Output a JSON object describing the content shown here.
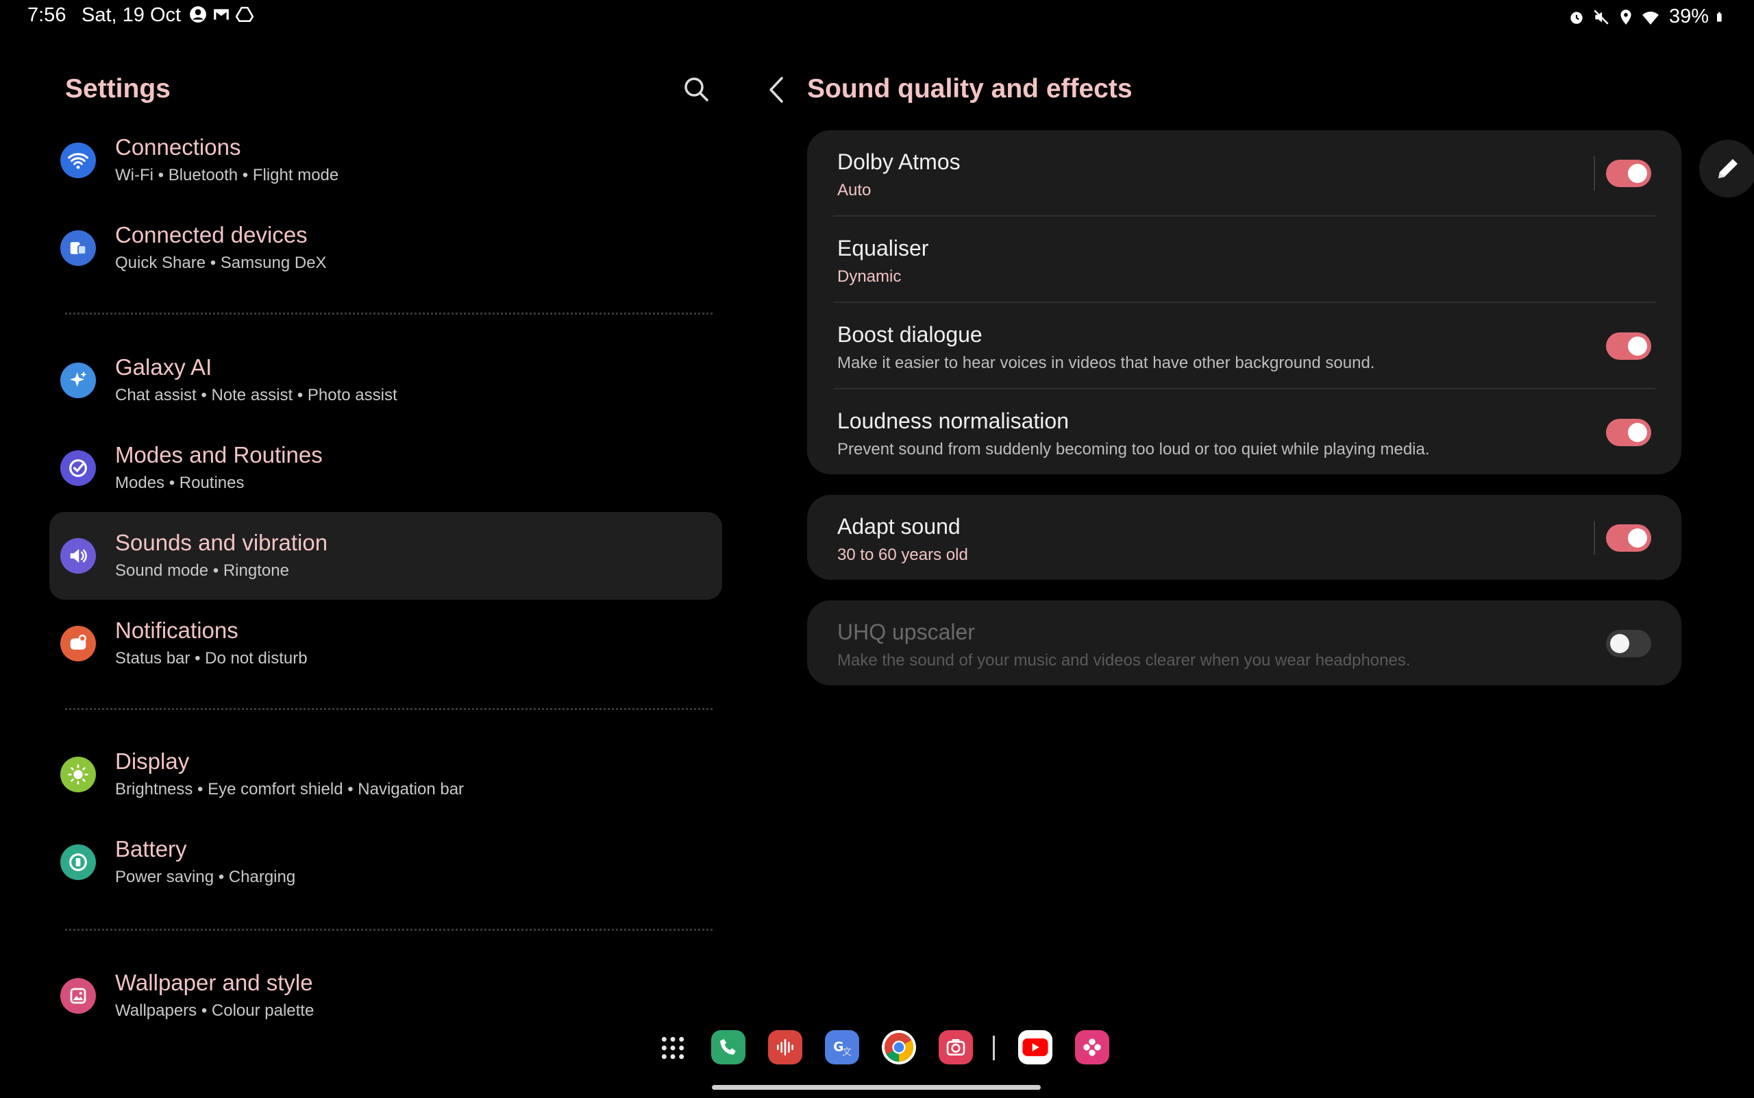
{
  "status_bar": {
    "time": "7:56",
    "date": "Sat, 19 Oct",
    "battery": "39%",
    "left_icons": [
      "account-icon",
      "gmail-icon",
      "drive-icon"
    ],
    "right_icons": [
      "alarm-icon",
      "mute-vibrate-icon",
      "location-icon",
      "wifi-icon"
    ]
  },
  "left_panel": {
    "title": "Settings",
    "items": [
      {
        "label": "Connections",
        "sub": "Wi-Fi  •  Bluetooth  •  Flight mode",
        "icon": "wifi-icon",
        "color": "#2f6fe0"
      },
      {
        "label": "Connected devices",
        "sub": "Quick Share  •  Samsung DeX",
        "icon": "devices-icon",
        "color": "#3a6fd8"
      },
      {
        "label": "Galaxy AI",
        "sub": "Chat assist  •  Note assist  •  Photo assist",
        "icon": "sparkle-icon",
        "color": "#3f8ee0"
      },
      {
        "label": "Modes and Routines",
        "sub": "Modes  •  Routines",
        "icon": "check-circle-icon",
        "color": "#5b52d6"
      },
      {
        "label": "Sounds and vibration",
        "sub": "Sound mode  •  Ringtone",
        "icon": "speaker-icon",
        "color": "#6b5bd6"
      },
      {
        "label": "Notifications",
        "sub": "Status bar  •  Do not disturb",
        "icon": "bell-icon",
        "color": "#e2613b"
      },
      {
        "label": "Display",
        "sub": "Brightness  •  Eye comfort shield  •  Navigation bar",
        "icon": "sun-icon",
        "color": "#8cc43a"
      },
      {
        "label": "Battery",
        "sub": "Power saving  •  Charging",
        "icon": "battery-icon",
        "color": "#2fa98a"
      },
      {
        "label": "Wallpaper and style",
        "sub": "Wallpapers  •  Colour palette",
        "icon": "image-icon",
        "color": "#d54f7a"
      }
    ]
  },
  "right_panel": {
    "title": "Sound quality and effects",
    "card1": [
      {
        "label": "Dolby Atmos",
        "sub": "Auto",
        "toggle": true,
        "accent": true
      },
      {
        "label": "Equaliser",
        "sub": "Dynamic",
        "accent": true
      },
      {
        "label": "Boost dialogue",
        "sub": "Make it easier to hear voices in videos that have other background sound.",
        "toggle": true
      },
      {
        "label": "Loudness normalisation",
        "sub": "Prevent sound from suddenly becoming too loud or too quiet while playing media.",
        "toggle": true
      }
    ],
    "card2": {
      "label": "Adapt sound",
      "sub": "30 to 60 years old",
      "toggle": true
    },
    "card3": {
      "label": "UHQ upscaler",
      "sub": "Make the sound of your music and videos clearer when you wear headphones.",
      "toggle": false
    }
  },
  "dock": {
    "apps": [
      "app-drawer-icon",
      "phone-icon",
      "voice-recorder-icon",
      "google-translate-icon",
      "chrome-icon",
      "camera-icon",
      "youtube-icon",
      "blossom-icon"
    ]
  },
  "colors": {
    "accent": "#f2c4c4",
    "toggle_on": "#e06a74",
    "card_bg": "#1c1c1c"
  }
}
